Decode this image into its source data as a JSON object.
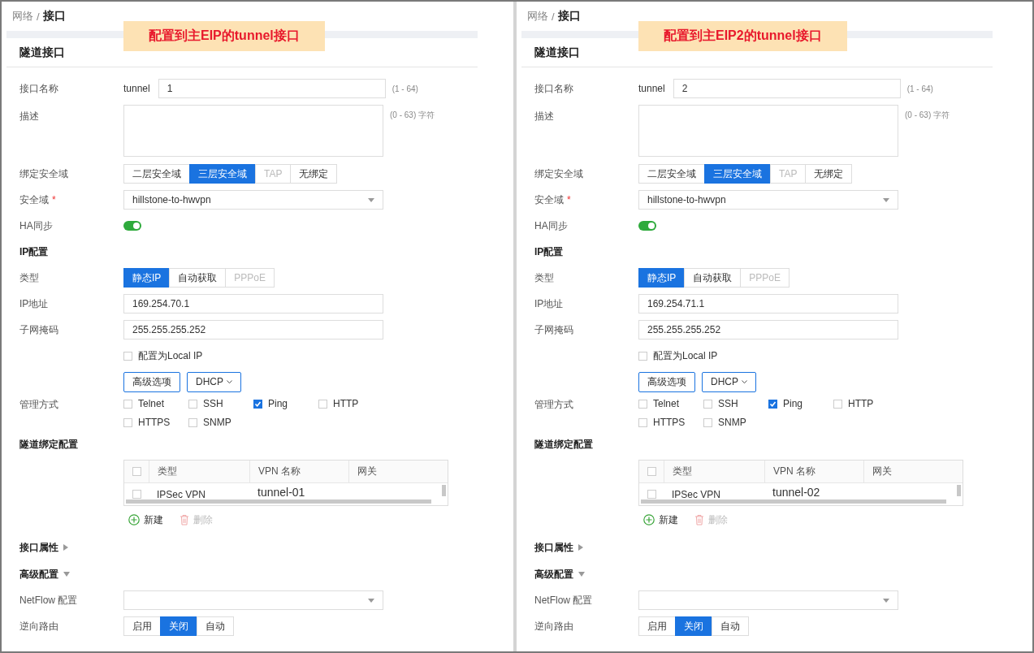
{
  "panels": [
    {
      "breadcrumb": {
        "parent": "网络",
        "separator": "/",
        "current": "接口"
      },
      "annotation": "配置到主EIP的tunnel接口",
      "section_title": "隧道接口",
      "rows": [
        {
          "kind": "text_input",
          "label": "接口名称",
          "prefix": "tunnel",
          "value": "1",
          "hint": "(1 - 64)"
        },
        {
          "kind": "textarea",
          "label": "描述",
          "hint": "(0 - 63) 字符"
        },
        {
          "kind": "segmented",
          "label": "绑定安全域",
          "options": [
            {
              "label": "二层安全域",
              "selected": false,
              "disabled": false
            },
            {
              "label": "三层安全域",
              "selected": true,
              "disabled": false
            },
            {
              "label": "TAP",
              "selected": false,
              "disabled": true
            },
            {
              "label": "无绑定",
              "selected": false,
              "disabled": false
            }
          ]
        },
        {
          "kind": "select",
          "label": "安全域",
          "required_mark": "*",
          "value": "hillstone-to-hwvpn"
        },
        {
          "kind": "toggle",
          "label": "HA同步",
          "on": true
        },
        {
          "kind": "heading",
          "label": "IP配置"
        },
        {
          "kind": "segmented",
          "label": "类型",
          "options": [
            {
              "label": "静态IP",
              "selected": true,
              "disabled": false
            },
            {
              "label": "自动获取",
              "selected": false,
              "disabled": false
            },
            {
              "label": "PPPoE",
              "selected": false,
              "disabled": true
            }
          ]
        },
        {
          "kind": "text_input",
          "label": "IP地址",
          "value": "169.254.70.1"
        },
        {
          "kind": "text_input",
          "label": "子网掩码",
          "value": "255.255.255.252"
        },
        {
          "kind": "checkbox",
          "text": "配置为Local IP",
          "checked": false
        },
        {
          "kind": "buttons",
          "items": [
            {
              "kind": "button",
              "label": "高级选项"
            },
            {
              "kind": "dropdown",
              "label": "DHCP"
            }
          ]
        },
        {
          "kind": "checkgroup",
          "label": "管理方式",
          "options": [
            {
              "label": "Telnet",
              "checked": false
            },
            {
              "label": "SSH",
              "checked": false
            },
            {
              "label": "Ping",
              "checked": true
            },
            {
              "label": "HTTP",
              "checked": false
            },
            {
              "label": "HTTPS",
              "checked": false
            },
            {
              "label": "SNMP",
              "checked": false
            }
          ]
        },
        {
          "kind": "heading",
          "label": "隧道绑定配置"
        },
        {
          "kind": "table",
          "header_checked": false,
          "columns": [
            "类型",
            "VPN 名称",
            "网关"
          ],
          "rows": [
            {
              "selected": false,
              "cells": [
                "IPSec VPN",
                "tunnel-01"
              ]
            }
          ]
        },
        {
          "kind": "actions",
          "items": [
            {
              "kind": "add",
              "label": "新建",
              "disabled": false
            },
            {
              "kind": "delete",
              "label": "删除",
              "disabled": true
            }
          ]
        },
        {
          "kind": "collapsible",
          "label": "接口属性",
          "expanded": false
        },
        {
          "kind": "collapsible",
          "label": "高级配置",
          "expanded": true
        },
        {
          "kind": "select",
          "label": "NetFlow 配置"
        },
        {
          "kind": "segmented",
          "label": "逆向路由",
          "options": [
            {
              "label": "启用",
              "selected": false,
              "disabled": false
            },
            {
              "label": "关闭",
              "selected": true,
              "disabled": false
            },
            {
              "label": "自动",
              "selected": false,
              "disabled": false
            }
          ]
        }
      ]
    },
    {
      "breadcrumb": {
        "parent": "网络",
        "separator": "/",
        "current": "接口"
      },
      "annotation": "配置到主EIP2的tunnel接口",
      "section_title": "隧道接口",
      "rows": [
        {
          "kind": "text_input",
          "label": "接口名称",
          "prefix": "tunnel",
          "value": "2",
          "hint": "(1 - 64)"
        },
        {
          "kind": "textarea",
          "label": "描述",
          "hint": "(0 - 63) 字符"
        },
        {
          "kind": "segmented",
          "label": "绑定安全域",
          "options": [
            {
              "label": "二层安全域",
              "selected": false,
              "disabled": false
            },
            {
              "label": "三层安全域",
              "selected": true,
              "disabled": false
            },
            {
              "label": "TAP",
              "selected": false,
              "disabled": true
            },
            {
              "label": "无绑定",
              "selected": false,
              "disabled": false
            }
          ]
        },
        {
          "kind": "select",
          "label": "安全域",
          "required_mark": "*",
          "value": "hillstone-to-hwvpn"
        },
        {
          "kind": "toggle",
          "label": "HA同步",
          "on": true
        },
        {
          "kind": "heading",
          "label": "IP配置"
        },
        {
          "kind": "segmented",
          "label": "类型",
          "options": [
            {
              "label": "静态IP",
              "selected": true,
              "disabled": false
            },
            {
              "label": "自动获取",
              "selected": false,
              "disabled": false
            },
            {
              "label": "PPPoE",
              "selected": false,
              "disabled": true
            }
          ]
        },
        {
          "kind": "text_input",
          "label": "IP地址",
          "value": "169.254.71.1"
        },
        {
          "kind": "text_input",
          "label": "子网掩码",
          "value": "255.255.255.252"
        },
        {
          "kind": "checkbox",
          "text": "配置为Local IP",
          "checked": false
        },
        {
          "kind": "buttons",
          "items": [
            {
              "kind": "button",
              "label": "高级选项"
            },
            {
              "kind": "dropdown",
              "label": "DHCP"
            }
          ]
        },
        {
          "kind": "checkgroup",
          "label": "管理方式",
          "options": [
            {
              "label": "Telnet",
              "checked": false
            },
            {
              "label": "SSH",
              "checked": false
            },
            {
              "label": "Ping",
              "checked": true
            },
            {
              "label": "HTTP",
              "checked": false
            },
            {
              "label": "HTTPS",
              "checked": false
            },
            {
              "label": "SNMP",
              "checked": false
            }
          ]
        },
        {
          "kind": "heading",
          "label": "隧道绑定配置"
        },
        {
          "kind": "table",
          "header_checked": false,
          "columns": [
            "类型",
            "VPN 名称",
            "网关"
          ],
          "rows": [
            {
              "selected": false,
              "cells": [
                "IPSec VPN",
                "tunnel-02"
              ]
            }
          ]
        },
        {
          "kind": "actions",
          "items": [
            {
              "kind": "add",
              "label": "新建",
              "disabled": false
            },
            {
              "kind": "delete",
              "label": "删除",
              "disabled": true
            }
          ]
        },
        {
          "kind": "collapsible",
          "label": "接口属性",
          "expanded": false
        },
        {
          "kind": "collapsible",
          "label": "高级配置",
          "expanded": true
        },
        {
          "kind": "select",
          "label": "NetFlow 配置"
        },
        {
          "kind": "segmented",
          "label": "逆向路由",
          "options": [
            {
              "label": "启用",
              "selected": false,
              "disabled": false
            },
            {
              "label": "关闭",
              "selected": true,
              "disabled": false
            },
            {
              "label": "自动",
              "selected": false,
              "disabled": false
            }
          ]
        }
      ]
    }
  ]
}
